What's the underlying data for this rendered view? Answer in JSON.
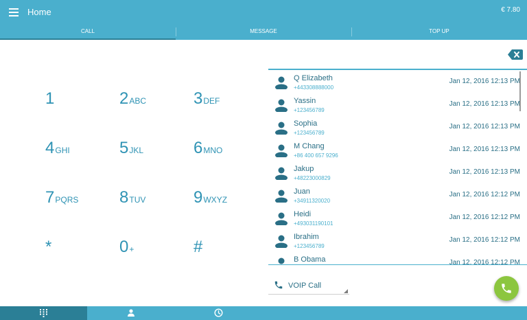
{
  "header": {
    "title": "Home",
    "balance": "€ 7.80",
    "menu_icon": "hamburger-menu-icon"
  },
  "tabs": [
    {
      "label": "CALL",
      "active": true
    },
    {
      "label": "MESSAGE",
      "active": false
    },
    {
      "label": "TOP UP",
      "active": false
    }
  ],
  "dialpad": {
    "keys": [
      {
        "digit": "1",
        "letters": ""
      },
      {
        "digit": "2",
        "letters": "ABC"
      },
      {
        "digit": "3",
        "letters": "DEF"
      },
      {
        "digit": "4",
        "letters": "GHI"
      },
      {
        "digit": "5",
        "letters": "JKL"
      },
      {
        "digit": "6",
        "letters": "MNO"
      },
      {
        "digit": "7",
        "letters": "PQRS"
      },
      {
        "digit": "8",
        "letters": "TUV"
      },
      {
        "digit": "9",
        "letters": "WXYZ"
      },
      {
        "digit": "*",
        "letters": ""
      },
      {
        "digit": "0",
        "letters": "+"
      },
      {
        "digit": "#",
        "letters": ""
      }
    ]
  },
  "recent_calls": [
    {
      "name": "Q Elizabeth",
      "number": "+443308888000",
      "time": "Jan 12, 2016 12:13 PM"
    },
    {
      "name": "Yassin",
      "number": "+123456789",
      "time": "Jan 12, 2016 12:13 PM"
    },
    {
      "name": "Sophia",
      "number": "+123456789",
      "time": "Jan 12, 2016 12:13 PM"
    },
    {
      "name": "M Chang",
      "number": "+86 400 657 9296",
      "time": "Jan 12, 2016 12:13 PM"
    },
    {
      "name": "Jakup",
      "number": "+48223000829",
      "time": "Jan 12, 2016 12:13 PM"
    },
    {
      "name": "Juan",
      "number": "+34911320020",
      "time": "Jan 12, 2016 12:12 PM"
    },
    {
      "name": "Heidi",
      "number": "+493031190101",
      "time": "Jan 12, 2016 12:12 PM"
    },
    {
      "name": "Ibrahim",
      "number": "+123456789",
      "time": "Jan 12, 2016 12:12 PM"
    },
    {
      "name": "B Obama",
      "number": "",
      "time": "Jan 12, 2016 12:12 PM"
    }
  ],
  "call_type": {
    "label": "VOIP Call",
    "icon": "phone-icon"
  },
  "call_button": {
    "icon": "phone-icon",
    "color": "#8cc63f"
  },
  "bottom_nav": [
    {
      "icon": "dialpad-icon",
      "active": true
    },
    {
      "icon": "contacts-icon",
      "active": false
    },
    {
      "icon": "history-icon",
      "active": false
    }
  ],
  "colors": {
    "primary": "#4aafcd",
    "primary_dark": "#2b7f96",
    "key_text": "#2f93b4",
    "call_green": "#8cc63f"
  }
}
